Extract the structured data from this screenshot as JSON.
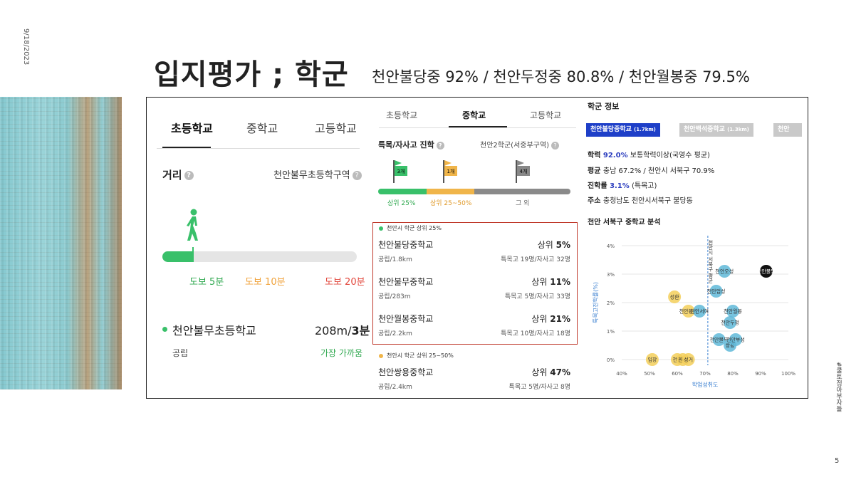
{
  "slide": {
    "date": "9/18/2023",
    "title": "입지평가 ; 학군",
    "subtitle": "천안불당중 92% / 천안두정중 80.8% / 천안월봉중 79.5%",
    "side_text": "#쿨토정아부자들",
    "page_number": "5"
  },
  "panel1": {
    "tabs": [
      "초등학교",
      "중학교",
      "고등학교"
    ],
    "active_tab": "초등학교",
    "distance_label": "거리",
    "zone_label": "천안불무초등학구역",
    "walk_labels": [
      {
        "text": "도보 5분",
        "color": "#2fa84f"
      },
      {
        "text": "도보 10분",
        "color": "#f0a23a"
      },
      {
        "text": "도보 20분",
        "color": "#e2473c"
      }
    ],
    "walk_progress_fraction": 0.16,
    "school_name": "천안불무초등학교",
    "school_distance": "208m/",
    "school_time": "3분",
    "school_type": "공립",
    "school_note": "가장 가까움"
  },
  "panel2": {
    "tabs": [
      "초등학교",
      "중학교",
      "고등학교"
    ],
    "active_tab": "중학교",
    "section_title": "특목/자사고 진학",
    "district": "천안2학군(서중부구역)",
    "flags": [
      {
        "label": "3개",
        "color": "#39c06a"
      },
      {
        "label": "1개",
        "color": "#f0b54a"
      },
      {
        "label": "4개",
        "color": "#888888"
      }
    ],
    "segments": [
      {
        "label": "상위 25%",
        "color": "#39c06a",
        "fraction": 0.25
      },
      {
        "label": "상위 25~50%",
        "color": "#f0b54a",
        "fraction": 0.25
      },
      {
        "label": "그 외",
        "color": "#8a8a8a",
        "fraction": 0.5
      }
    ],
    "group1_label": "천안시 학군 상위 25%",
    "group1_color": "#39c06a",
    "group1": [
      {
        "name": "천안불당중학교",
        "rank_prefix": "상위 ",
        "rank": "5%",
        "type": "공립/1.8km",
        "stats": "특목고 19명/자사고 32명"
      },
      {
        "name": "천안불무중학교",
        "rank_prefix": "상위 ",
        "rank": "11%",
        "type": "공립/283m",
        "stats": "특목고 5명/자사고 33명"
      },
      {
        "name": "천안월봉중학교",
        "rank_prefix": "상위 ",
        "rank": "21%",
        "type": "공립/2.2km",
        "stats": "특목고 10명/자사고 18명"
      }
    ],
    "group2_label": "천안시 학군 상위 25~50%",
    "group2_color": "#f0b54a",
    "group2": [
      {
        "name": "천안쌍용중학교",
        "rank_prefix": "상위 ",
        "rank": "47%",
        "type": "공립/2.4km",
        "stats": "특목고 5명/자사고 8명"
      }
    ]
  },
  "panel3": {
    "heading": "학군 정보",
    "tabs": [
      {
        "label": "천안불당중학교",
        "dist": "(1.7km)",
        "active": true
      },
      {
        "label": "천안백석중학교",
        "dist": "(1.3km)",
        "active": false
      },
      {
        "label": "천안",
        "dist": "",
        "active": false
      }
    ],
    "info": {
      "l1_label": "학력 ",
      "l1_value": "92.0%",
      "l1_rest": " 보통학력이상(국영수 평균)",
      "l2_label": "평균 ",
      "l2_rest": "충남 67.2% / 천안시 서북구 70.9%",
      "l3_label": "진학률 ",
      "l3_value": "3.1%",
      "l3_rest": " (특목고)",
      "l4_label": "주소 ",
      "l4_rest": "충청남도 천안시서북구 불당동"
    },
    "chart_title": "천안 서북구 중학교 분석"
  },
  "chart_data": {
    "type": "scatter",
    "title": "천안 서북구 중학교 분석",
    "xlabel": "학업성취도",
    "ylabel": "특목고진학률(%)",
    "x_ticks": [
      "40%",
      "50%",
      "60%",
      "70%",
      "80%",
      "90%",
      "100%"
    ],
    "y_ticks": [
      "0%",
      "1%",
      "2%",
      "3%",
      "4%"
    ],
    "xlim": [
      40,
      100
    ],
    "ylim": [
      -0.2,
      4.2
    ],
    "avg_x": 71,
    "avg_y_label": "천안시 서북구 평균",
    "points": [
      {
        "label": "천안오성",
        "x": 77,
        "y": 3.1,
        "color": "#5fb9d8"
      },
      {
        "label": "천안불당",
        "x": 92,
        "y": 3.1,
        "color": "#111111"
      },
      {
        "label": "천안업성",
        "x": 74,
        "y": 2.4,
        "color": "#5fb9d8"
      },
      {
        "label": "성환",
        "x": 59,
        "y": 2.2,
        "color": "#f3cf5a"
      },
      {
        "label": "천안봉서",
        "x": 64,
        "y": 1.7,
        "color": "#f3cf5a"
      },
      {
        "label": "천안서여",
        "x": 68,
        "y": 1.7,
        "color": "#5fb9d8"
      },
      {
        "label": "천안월봉",
        "x": 80,
        "y": 1.7,
        "color": "#5fb9d8"
      },
      {
        "label": "천안두정",
        "x": 79,
        "y": 1.3,
        "color": "#5fb9d8"
      },
      {
        "label": "천안불무",
        "x": 75,
        "y": 0.7,
        "color": "#5fb9d8"
      },
      {
        "label": "쌍용",
        "x": 79,
        "y": 0.5,
        "color": "#5fb9d8"
      },
      {
        "label": "천안부성",
        "x": 81,
        "y": 0.7,
        "color": "#5fb9d8"
      },
      {
        "label": "입장",
        "x": 51,
        "y": 0.0,
        "color": "#f3cf5a"
      },
      {
        "label": "천안",
        "x": 60,
        "y": 0.0,
        "color": "#f3cf5a"
      },
      {
        "label": "환서",
        "x": 62,
        "y": 0.0,
        "color": "#f3cf5a"
      },
      {
        "label": "성거",
        "x": 64,
        "y": 0.0,
        "color": "#f3cf5a"
      }
    ]
  }
}
